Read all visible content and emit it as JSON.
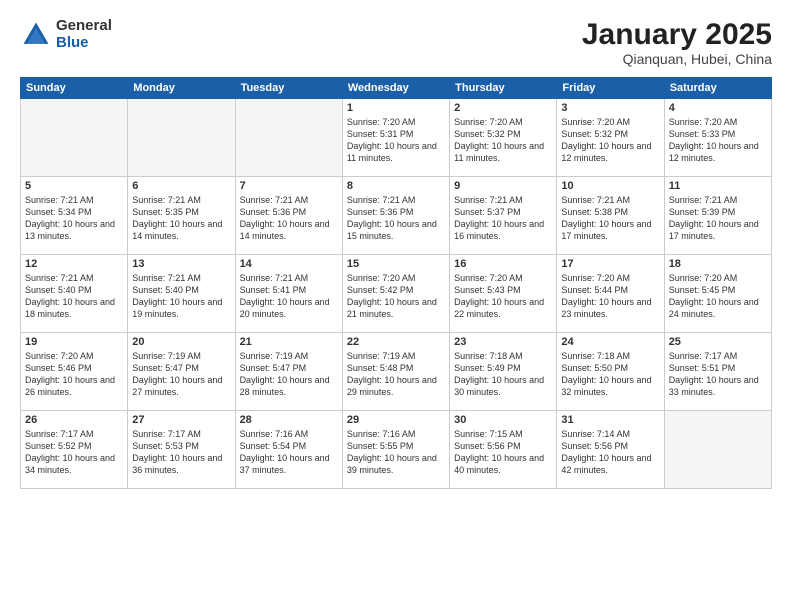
{
  "logo": {
    "general": "General",
    "blue": "Blue"
  },
  "title": "January 2025",
  "subtitle": "Qianquan, Hubei, China",
  "days_of_week": [
    "Sunday",
    "Monday",
    "Tuesday",
    "Wednesday",
    "Thursday",
    "Friday",
    "Saturday"
  ],
  "weeks": [
    [
      {
        "day": "",
        "empty": true
      },
      {
        "day": "",
        "empty": true
      },
      {
        "day": "",
        "empty": true
      },
      {
        "day": "1",
        "sunrise": "7:20 AM",
        "sunset": "5:31 PM",
        "daylight": "10 hours and 11 minutes."
      },
      {
        "day": "2",
        "sunrise": "7:20 AM",
        "sunset": "5:32 PM",
        "daylight": "10 hours and 11 minutes."
      },
      {
        "day": "3",
        "sunrise": "7:20 AM",
        "sunset": "5:32 PM",
        "daylight": "10 hours and 12 minutes."
      },
      {
        "day": "4",
        "sunrise": "7:20 AM",
        "sunset": "5:33 PM",
        "daylight": "10 hours and 12 minutes."
      }
    ],
    [
      {
        "day": "5",
        "sunrise": "7:21 AM",
        "sunset": "5:34 PM",
        "daylight": "10 hours and 13 minutes."
      },
      {
        "day": "6",
        "sunrise": "7:21 AM",
        "sunset": "5:35 PM",
        "daylight": "10 hours and 14 minutes."
      },
      {
        "day": "7",
        "sunrise": "7:21 AM",
        "sunset": "5:36 PM",
        "daylight": "10 hours and 14 minutes."
      },
      {
        "day": "8",
        "sunrise": "7:21 AM",
        "sunset": "5:36 PM",
        "daylight": "10 hours and 15 minutes."
      },
      {
        "day": "9",
        "sunrise": "7:21 AM",
        "sunset": "5:37 PM",
        "daylight": "10 hours and 16 minutes."
      },
      {
        "day": "10",
        "sunrise": "7:21 AM",
        "sunset": "5:38 PM",
        "daylight": "10 hours and 17 minutes."
      },
      {
        "day": "11",
        "sunrise": "7:21 AM",
        "sunset": "5:39 PM",
        "daylight": "10 hours and 17 minutes."
      }
    ],
    [
      {
        "day": "12",
        "sunrise": "7:21 AM",
        "sunset": "5:40 PM",
        "daylight": "10 hours and 18 minutes."
      },
      {
        "day": "13",
        "sunrise": "7:21 AM",
        "sunset": "5:40 PM",
        "daylight": "10 hours and 19 minutes."
      },
      {
        "day": "14",
        "sunrise": "7:21 AM",
        "sunset": "5:41 PM",
        "daylight": "10 hours and 20 minutes."
      },
      {
        "day": "15",
        "sunrise": "7:20 AM",
        "sunset": "5:42 PM",
        "daylight": "10 hours and 21 minutes."
      },
      {
        "day": "16",
        "sunrise": "7:20 AM",
        "sunset": "5:43 PM",
        "daylight": "10 hours and 22 minutes."
      },
      {
        "day": "17",
        "sunrise": "7:20 AM",
        "sunset": "5:44 PM",
        "daylight": "10 hours and 23 minutes."
      },
      {
        "day": "18",
        "sunrise": "7:20 AM",
        "sunset": "5:45 PM",
        "daylight": "10 hours and 24 minutes."
      }
    ],
    [
      {
        "day": "19",
        "sunrise": "7:20 AM",
        "sunset": "5:46 PM",
        "daylight": "10 hours and 26 minutes."
      },
      {
        "day": "20",
        "sunrise": "7:19 AM",
        "sunset": "5:47 PM",
        "daylight": "10 hours and 27 minutes."
      },
      {
        "day": "21",
        "sunrise": "7:19 AM",
        "sunset": "5:47 PM",
        "daylight": "10 hours and 28 minutes."
      },
      {
        "day": "22",
        "sunrise": "7:19 AM",
        "sunset": "5:48 PM",
        "daylight": "10 hours and 29 minutes."
      },
      {
        "day": "23",
        "sunrise": "7:18 AM",
        "sunset": "5:49 PM",
        "daylight": "10 hours and 30 minutes."
      },
      {
        "day": "24",
        "sunrise": "7:18 AM",
        "sunset": "5:50 PM",
        "daylight": "10 hours and 32 minutes."
      },
      {
        "day": "25",
        "sunrise": "7:17 AM",
        "sunset": "5:51 PM",
        "daylight": "10 hours and 33 minutes."
      }
    ],
    [
      {
        "day": "26",
        "sunrise": "7:17 AM",
        "sunset": "5:52 PM",
        "daylight": "10 hours and 34 minutes."
      },
      {
        "day": "27",
        "sunrise": "7:17 AM",
        "sunset": "5:53 PM",
        "daylight": "10 hours and 36 minutes."
      },
      {
        "day": "28",
        "sunrise": "7:16 AM",
        "sunset": "5:54 PM",
        "daylight": "10 hours and 37 minutes."
      },
      {
        "day": "29",
        "sunrise": "7:16 AM",
        "sunset": "5:55 PM",
        "daylight": "10 hours and 39 minutes."
      },
      {
        "day": "30",
        "sunrise": "7:15 AM",
        "sunset": "5:56 PM",
        "daylight": "10 hours and 40 minutes."
      },
      {
        "day": "31",
        "sunrise": "7:14 AM",
        "sunset": "5:56 PM",
        "daylight": "10 hours and 42 minutes."
      },
      {
        "day": "",
        "empty": true
      }
    ]
  ]
}
